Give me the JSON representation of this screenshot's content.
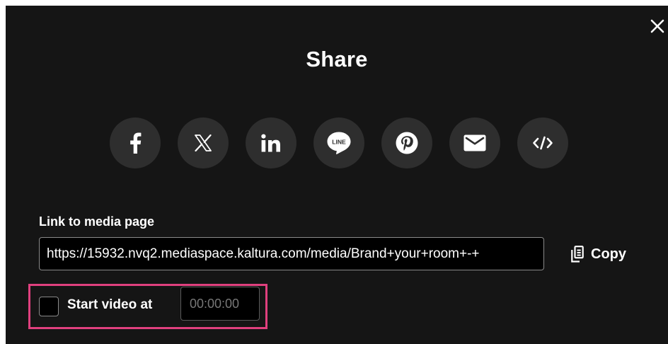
{
  "dialog": {
    "title": "Share",
    "close_icon": "close-icon"
  },
  "social_buttons": [
    {
      "name": "facebook",
      "icon": "facebook-icon"
    },
    {
      "name": "x",
      "icon": "x-twitter-icon"
    },
    {
      "name": "linkedin",
      "icon": "linkedin-icon"
    },
    {
      "name": "line",
      "icon": "line-icon",
      "icon_text": "LINE"
    },
    {
      "name": "pinterest",
      "icon": "pinterest-icon"
    },
    {
      "name": "email",
      "icon": "envelope-icon"
    },
    {
      "name": "embed",
      "icon": "code-icon"
    }
  ],
  "link": {
    "label": "Link to media page",
    "value": "https://15932.nvq2.mediaspace.kaltura.com/media/Brand+your+room+-+",
    "copy_label": "Copy",
    "copy_icon": "copy-icon"
  },
  "start_video": {
    "label": "Start video at",
    "checked": false,
    "time_placeholder": "00:00:00"
  },
  "colors": {
    "background": "#151515",
    "button_bg": "#2e2e2e",
    "highlight": "#e0407e"
  }
}
